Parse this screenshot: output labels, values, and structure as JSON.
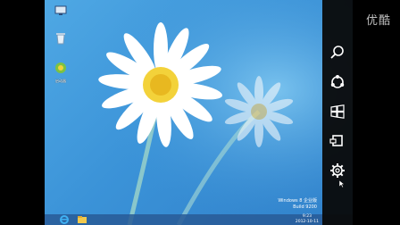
{
  "watermark": "优酷",
  "desktop_icons": [
    {
      "name": "computer-icon",
      "label": ""
    },
    {
      "name": "recycle-bin-icon",
      "label": ""
    },
    {
      "name": "app-shortcut-icon",
      "label": "启动器"
    }
  ],
  "charms": [
    "search-icon",
    "share-icon",
    "start-icon",
    "devices-icon",
    "settings-icon"
  ],
  "windows_build": {
    "line1": "Windows 8 企业版",
    "line2": "Build 9200"
  },
  "taskbar": {
    "icons": [
      "ie-icon",
      "explorer-icon"
    ],
    "time": "9:23",
    "date": "2012-10-11"
  },
  "colors": {
    "desktop": "#3b93d8",
    "charms_bg": "#0a0a0a",
    "letterbox": "#000000"
  }
}
